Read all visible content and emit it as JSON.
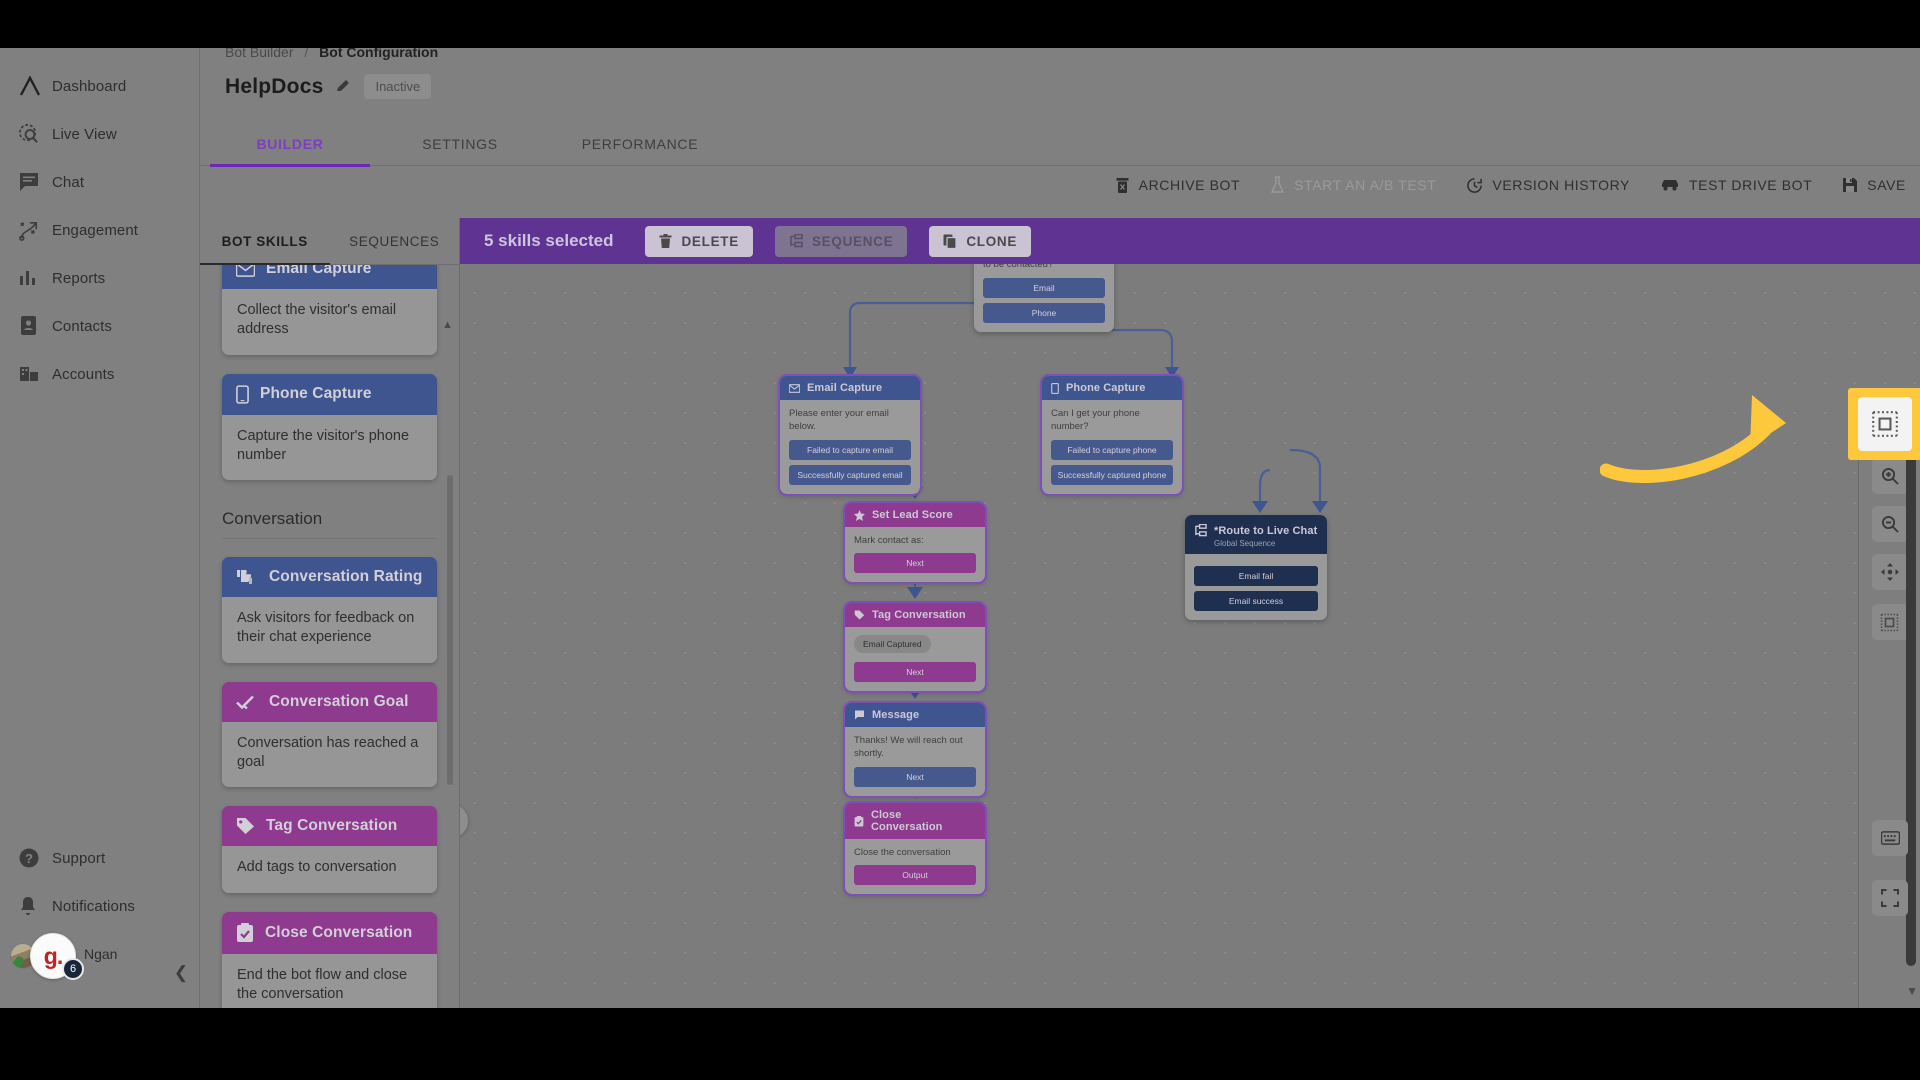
{
  "sidebar": {
    "items": [
      {
        "label": "Dashboard",
        "icon": "logo-icon"
      },
      {
        "label": "Live View",
        "icon": "live-view-icon"
      },
      {
        "label": "Chat",
        "icon": "chat-icon"
      },
      {
        "label": "Engagement",
        "icon": "engagement-icon"
      },
      {
        "label": "Reports",
        "icon": "reports-icon"
      },
      {
        "label": "Contacts",
        "icon": "contacts-icon"
      },
      {
        "label": "Accounts",
        "icon": "accounts-icon"
      }
    ],
    "bottom": [
      {
        "label": "Support",
        "icon": "help-icon"
      },
      {
        "label": "Notifications",
        "icon": "bell-icon"
      }
    ],
    "user": {
      "name": "Ngan",
      "badge_letter": "g.",
      "badge_count": "6"
    }
  },
  "breadcrumb": {
    "parent": "Bot Builder",
    "separator": "/",
    "current": "Bot Configuration"
  },
  "header": {
    "bot_name": "HelpDocs",
    "edit_icon": "pencil-icon",
    "status": "Inactive",
    "tabs": [
      {
        "label": "BUILDER",
        "active": true
      },
      {
        "label": "SETTINGS",
        "active": false
      },
      {
        "label": "PERFORMANCE",
        "active": false
      }
    ]
  },
  "toolbar": {
    "buttons": [
      {
        "label": "ARCHIVE BOT",
        "icon": "archive-icon",
        "disabled": false
      },
      {
        "label": "START AN A/B TEST",
        "icon": "flask-icon",
        "disabled": true
      },
      {
        "label": "VERSION HISTORY",
        "icon": "history-icon",
        "disabled": false
      },
      {
        "label": "TEST DRIVE BOT",
        "icon": "car-icon",
        "disabled": false
      },
      {
        "label": "SAVE",
        "icon": "save-icon",
        "disabled": false
      }
    ]
  },
  "skills_panel": {
    "tabs": [
      {
        "label": "BOT SKILLS",
        "active": true
      },
      {
        "label": "SEQUENCES",
        "active": false
      }
    ],
    "cards": [
      {
        "title": "Email Capture",
        "desc": "Collect the visitor's email address",
        "color": "blue",
        "icon": "envelope-icon",
        "clipped_top": true
      },
      {
        "title": "Phone Capture",
        "desc": "Capture the visitor's phone number",
        "color": "blue",
        "icon": "phone-icon"
      }
    ],
    "section_title": "Conversation",
    "section_cards": [
      {
        "title": "Conversation Rating",
        "desc": "Ask visitors for feedback on their chat experience",
        "color": "blue",
        "icon": "thumbs-icon"
      },
      {
        "title": "Conversation Goal",
        "desc": "Conversation has reached a goal",
        "color": "purple",
        "icon": "check-icon"
      },
      {
        "title": "Tag Conversation",
        "desc": "Add tags to conversation",
        "color": "purple",
        "icon": "tag-icon"
      },
      {
        "title": "Close Conversation",
        "desc": "End the bot flow and close the conversation",
        "color": "purple",
        "icon": "clipboard-check-icon"
      }
    ]
  },
  "selection_bar": {
    "text": "5 skills selected",
    "buttons": [
      {
        "label": "DELETE",
        "icon": "trash-icon",
        "muted": false
      },
      {
        "label": "SEQUENCE",
        "icon": "sequence-icon",
        "muted": true
      },
      {
        "label": "CLONE",
        "icon": "clone-icon",
        "muted": false
      }
    ]
  },
  "canvas": {
    "nodes": [
      {
        "id": "ask",
        "title": "",
        "text": "Thanks! How would you like to be contacted?",
        "buttons": [
          "Email",
          "Phone"
        ],
        "color": "blue",
        "headless": true
      },
      {
        "id": "email_capture",
        "title": "Email Capture",
        "icon": "envelope-icon",
        "text": "Please enter your email below.",
        "buttons": [
          "Failed to capture email",
          "Successfully captured email"
        ],
        "color": "blue",
        "selected": true
      },
      {
        "id": "phone_capture",
        "title": "Phone Capture",
        "icon": "phone-icon",
        "text": "Can I get your phone number?",
        "buttons": [
          "Failed to capture phone",
          "Successfully captured phone"
        ],
        "color": "blue",
        "selected": true
      },
      {
        "id": "lead_score",
        "title": "Set Lead Score",
        "icon": "star-icon",
        "text": "Mark contact as:",
        "buttons": [
          "Next"
        ],
        "color": "purple",
        "selected": true
      },
      {
        "id": "tag_conv",
        "title": "Tag Conversation",
        "icon": "tag-icon",
        "chip": "Email Captured",
        "buttons": [
          "Next"
        ],
        "color": "purple",
        "selected": true
      },
      {
        "id": "message",
        "title": "Message",
        "icon": "message-icon",
        "text": "Thanks! We will reach out shortly.",
        "buttons": [
          "Next"
        ],
        "color": "blue",
        "selected": true
      },
      {
        "id": "close_conv",
        "title": "Close Conversation",
        "icon": "clipboard-check-icon",
        "text": "Close the conversation",
        "buttons": [
          "Output"
        ],
        "color": "purple",
        "selected": true
      },
      {
        "id": "route_live",
        "title": "*Route to Live Chat",
        "subtitle": "Global Sequence",
        "icon": "sequence-icon",
        "buttons": [
          "Email fail",
          "Email success"
        ],
        "color": "navy"
      }
    ]
  },
  "rail": {
    "buttons": [
      {
        "icon": "focus-icon",
        "name": "focus-button"
      },
      {
        "icon": "zoom-in-icon",
        "name": "zoom-in-button"
      },
      {
        "icon": "zoom-out-icon",
        "name": "zoom-out-button"
      },
      {
        "icon": "pan-icon",
        "name": "pan-button"
      },
      {
        "icon": "minimap-icon",
        "name": "minimap-button",
        "highlighted": true
      }
    ],
    "bottom_buttons": [
      {
        "icon": "keyboard-icon",
        "name": "keyboard-shortcuts-button"
      },
      {
        "icon": "fullscreen-icon",
        "name": "fullscreen-button"
      }
    ]
  },
  "canvas_collapse": {
    "icon": "chevron-left-icon"
  },
  "colors": {
    "accent_purple": "#6d28b8",
    "selection_bar": "#5e3392",
    "highlight_yellow": "#fdc83c",
    "node_blue": "#3f5590",
    "node_purple": "#8e3a8e",
    "node_navy": "#1e2f4f"
  }
}
